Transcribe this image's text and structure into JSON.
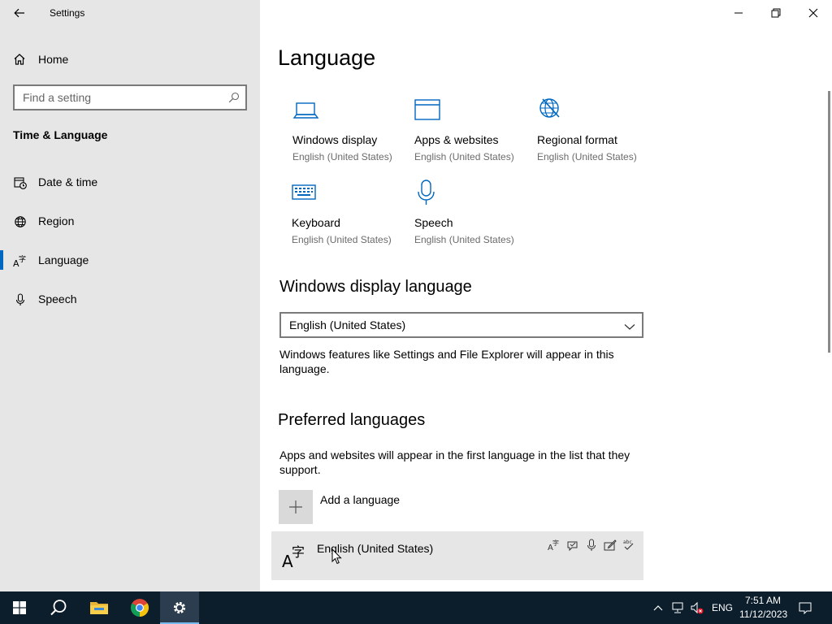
{
  "window": {
    "title": "Settings"
  },
  "sidebar": {
    "home_label": "Home",
    "search_placeholder": "Find a setting",
    "section_title": "Time & Language",
    "items": [
      {
        "label": "Date & time",
        "icon": "date-time-icon"
      },
      {
        "label": "Region",
        "icon": "globe-icon"
      },
      {
        "label": "Language",
        "icon": "language-icon",
        "active": true
      },
      {
        "label": "Speech",
        "icon": "microphone-icon"
      }
    ]
  },
  "main": {
    "title": "Language",
    "tiles": [
      {
        "name": "Windows display",
        "sub": "English (United States)",
        "icon": "laptop-icon"
      },
      {
        "name": "Apps & websites",
        "sub": "English (United States)",
        "icon": "browser-window-icon"
      },
      {
        "name": "Regional format",
        "sub": "English (United States)",
        "icon": "globe-format-icon"
      },
      {
        "name": "Keyboard",
        "sub": "English (United States)",
        "icon": "keyboard-icon"
      },
      {
        "name": "Speech",
        "sub": "English (United States)",
        "icon": "microphone-icon"
      }
    ],
    "display_language": {
      "heading": "Windows display language",
      "selected": "English (United States)",
      "description": "Windows features like Settings and File Explorer will appear in this language."
    },
    "preferred": {
      "heading": "Preferred languages",
      "description": "Apps and websites will appear in the first language in the list that they support.",
      "add_label": "Add a language",
      "languages": [
        {
          "name": "English (United States)",
          "features": [
            "display-language-icon",
            "text-to-speech-icon",
            "speech-recognition-icon",
            "handwriting-icon",
            "spellcheck-icon"
          ]
        }
      ]
    }
  },
  "taskbar": {
    "apps": [
      "start-icon",
      "search-icon",
      "file-explorer-icon",
      "chrome-icon",
      "settings-icon"
    ],
    "tray": {
      "input_lang": "ENG",
      "time": "7:51 AM",
      "date": "11/12/2023"
    }
  },
  "colors": {
    "accent": "#0067c0",
    "sidebar_bg": "#e6e6e6",
    "taskbar_bg": "#0c1d2c"
  }
}
